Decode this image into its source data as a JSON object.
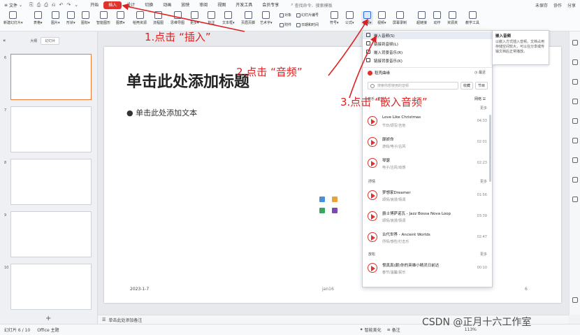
{
  "menubar": {
    "file_label": "文件",
    "quick_icons": [
      "⎘",
      "⎙",
      "⎙",
      "⎌",
      "↶",
      "↷",
      "⌄"
    ],
    "tabs": [
      "开始",
      "插入",
      "设计",
      "切换",
      "动画",
      "放映",
      "审阅",
      "视图",
      "开发工具",
      "会员专享"
    ],
    "active_tab": "插入",
    "search_placeholder": "查找命令、搜索模板",
    "right_items": [
      "未保存",
      "协作",
      "分享"
    ]
  },
  "ribbon": {
    "buttons": [
      {
        "label": "新建幻灯片▾",
        "icon": "new-slide"
      },
      {
        "label": "表格▾",
        "icon": "table"
      },
      {
        "label": "图片▾",
        "icon": "image"
      },
      {
        "label": "形状▾",
        "icon": "shape"
      },
      {
        "label": "图标▾",
        "icon": "icon"
      },
      {
        "label": "智能图形",
        "icon": "smartart"
      },
      {
        "label": "图表▾",
        "icon": "chart"
      },
      {
        "label": "稻壳资源",
        "icon": "docer"
      },
      {
        "label": "流程图",
        "icon": "flowchart"
      },
      {
        "label": "思维导图",
        "icon": "mindmap"
      },
      {
        "label": "更多▾",
        "icon": "more"
      },
      {
        "label": "批注",
        "icon": "comment"
      },
      {
        "label": "文本框▾",
        "icon": "textbox"
      },
      {
        "label": "页眉页脚",
        "icon": "header-footer"
      },
      {
        "label": "艺术字▾",
        "icon": "wordart"
      },
      {
        "label": "符号▾",
        "icon": "symbol"
      },
      {
        "label": "公式▾",
        "icon": "formula"
      },
      {
        "label": "音频▾",
        "icon": "audio"
      },
      {
        "label": "视频▾",
        "icon": "video"
      },
      {
        "label": "屏幕录制",
        "icon": "screen-record"
      },
      {
        "label": "超链接",
        "icon": "hyperlink"
      },
      {
        "label": "动作",
        "icon": "action"
      },
      {
        "label": "资源夹",
        "icon": "resource"
      },
      {
        "label": "教学工具",
        "icon": "teaching"
      }
    ],
    "small": [
      "对象",
      "幻灯片编号",
      "附件",
      "日期和时间"
    ]
  },
  "leftpanel": {
    "tabs": [
      "大纲",
      "幻灯片"
    ],
    "active_tab": "幻灯片",
    "slide_numbers": [
      "6",
      "7",
      "8",
      "9",
      "10"
    ],
    "add_label": "+"
  },
  "slide": {
    "title": "单击此处添加标题",
    "body": "● 单击此处添加文本",
    "date": "2023-1-7",
    "footer": "jan16",
    "number": "6"
  },
  "notes": {
    "label": "单击此处添加备注"
  },
  "status": {
    "slide_pos": "幻灯片 6 / 10",
    "theme": "Office 主题",
    "smart": "智能美化",
    "notes": "备注",
    "zoom": "113%"
  },
  "dropdown": {
    "items": [
      "嵌入音频(S)",
      "链接到音频(L)",
      "嵌入背景音乐(R)",
      "链接背景音乐(K)"
    ],
    "section_title": "稻壳曲缘",
    "recent": "最近",
    "search_placeholder": "搜索你想使用的音频",
    "btn_fav": "收藏",
    "btn_list": "节目",
    "categories": [
      "音乐",
      "音效"
    ],
    "network": "网络 ☰",
    "groups": [
      {
        "name": "",
        "more": "更多",
        "songs": [
          {
            "title": "Love Like Christmas",
            "tags": "节日/颂写/吉他",
            "duration": "04:33"
          },
          {
            "title": "颠娇命",
            "tags": "游戏/电子/古风",
            "duration": "02:01"
          },
          {
            "title": "琴瑟",
            "tags": "电子/古风/动感",
            "duration": "02:23"
          }
        ]
      },
      {
        "name": "抒情",
        "more": "更多",
        "songs": [
          {
            "title": "梦想家Dreamer",
            "tags": "颂情/浪漫/情调",
            "duration": "01:56"
          },
          {
            "title": "爵士博萨诺瓦 - Jazz Bossa Nova Loop",
            "tags": "颂情/浪漫/情调",
            "duration": "03:39"
          },
          {
            "title": "古代世界 - Ancient Worlds",
            "tags": "抒情/感性/打击乐",
            "duration": "02:47"
          }
        ]
      },
      {
        "name": "放松",
        "more": "更多",
        "songs": [
          {
            "title": "恨真真(颠)你的英雄小精灵日前达",
            "tags": "春节/温馨/民乐",
            "duration": "00:10"
          }
        ]
      }
    ]
  },
  "tooltip": {
    "title": "嵌入音频",
    "body": "以嵌入方式插入音频。文档占用存储空间较大，可以在分享或传输文档后正常播放。"
  },
  "annotations": {
    "step1": "1.点击 “插入”",
    "step2": "2.点击 “音频”",
    "step3": "3.点击 “嵌入音频”"
  },
  "watermark": "CSDN @正月十六工作室",
  "colors": {
    "accent": "#e0322d",
    "arrow": "#e02020",
    "selected_tab_bg": "#e0322d"
  }
}
